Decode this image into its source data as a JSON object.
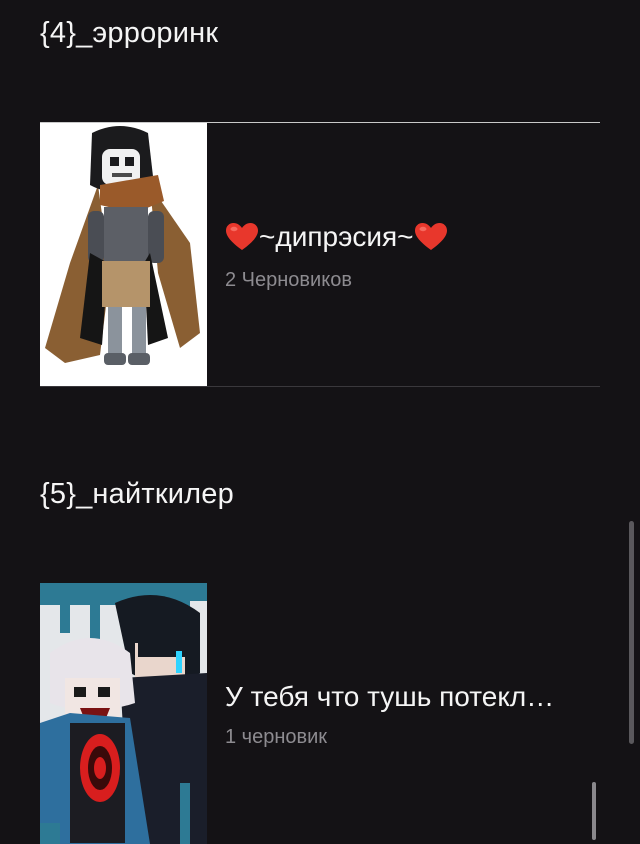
{
  "sections": [
    {
      "title": "{4}_эрроринк",
      "story": {
        "title_text": "~дипрэсия~",
        "title_prefix_icon": "red-heart-emoji",
        "title_suffix_icon": "red-heart-emoji",
        "meta": "2 Черновиков",
        "cover_icon": "character-cover-image-hooded-skeleton"
      }
    },
    {
      "title": "{5}_найткилер",
      "story": {
        "title_text": "У тебя что тушь потекл…",
        "meta": "1 черновик",
        "cover_icon": "character-cover-image-anime-duo"
      }
    }
  ],
  "colors": {
    "background": "#141215",
    "title_text": "#f5f5f5",
    "meta_text": "#8d8b90",
    "heart": "#e8372c",
    "divider": "#3a383c",
    "scrollbar": "#5a585c"
  }
}
